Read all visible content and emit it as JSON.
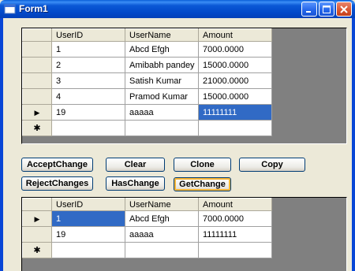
{
  "window": {
    "title": "Form1"
  },
  "grid_top": {
    "columns": [
      "UserID",
      "UserName",
      "Amount"
    ],
    "rows": [
      {
        "marker": "",
        "cells": [
          "1",
          "Abcd Efgh",
          "7000.0000"
        ]
      },
      {
        "marker": "",
        "cells": [
          "2",
          "Amibabh pandey",
          "15000.0000"
        ]
      },
      {
        "marker": "",
        "cells": [
          "3",
          "Satish Kumar",
          "21000.0000"
        ]
      },
      {
        "marker": "",
        "cells": [
          "4",
          "Pramod Kumar",
          "15000.0000"
        ]
      },
      {
        "marker": "▶",
        "cells": [
          "19",
          "aaaaa",
          "11111111"
        ]
      },
      {
        "marker": "✱",
        "cells": [
          "",
          "",
          ""
        ]
      }
    ]
  },
  "buttons": {
    "accept_change": "AcceptChange",
    "clear": "Clear",
    "clone": "Clone",
    "copy": "Copy",
    "reject_changes": "RejectChanges",
    "has_change": "HasChange",
    "get_change": "GetChange"
  },
  "grid_bottom": {
    "columns": [
      "UserID",
      "UserName",
      "Amount"
    ],
    "rows": [
      {
        "marker": "▶",
        "cells": [
          "1",
          "Abcd Efgh",
          "7000.0000"
        ]
      },
      {
        "marker": "",
        "cells": [
          "19",
          "aaaaa",
          "11111111"
        ]
      },
      {
        "marker": "✱",
        "cells": [
          "",
          "",
          ""
        ]
      }
    ]
  }
}
